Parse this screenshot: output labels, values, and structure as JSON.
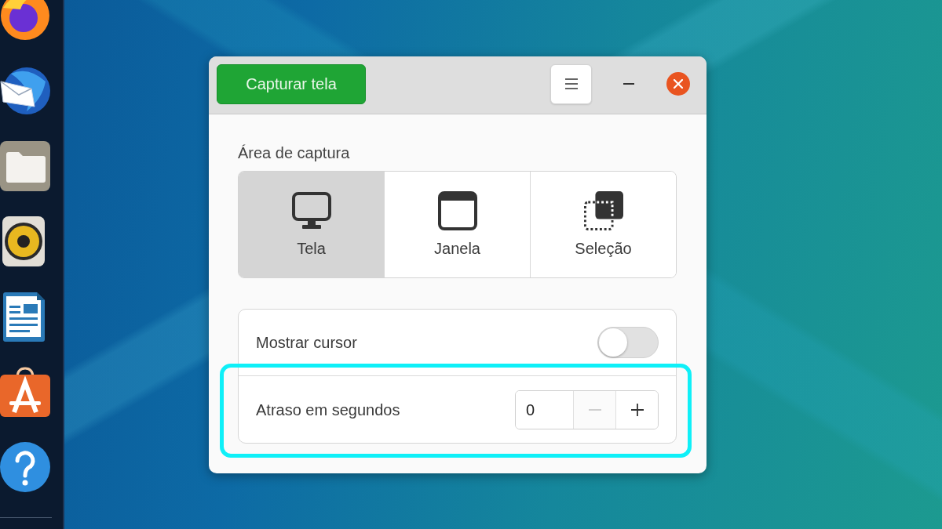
{
  "window": {
    "header": {
      "primary_button": "Capturar tela"
    },
    "capture_area": {
      "label": "Área de captura",
      "options": [
        {
          "kind": "screen",
          "label": "Tela",
          "selected": true
        },
        {
          "kind": "window",
          "label": "Janela",
          "selected": false
        },
        {
          "kind": "selection",
          "label": "Seleção",
          "selected": false
        }
      ]
    },
    "settings": [
      {
        "kind": "switch",
        "label": "Mostrar cursor",
        "on": false,
        "highlighted": false
      },
      {
        "kind": "spin",
        "label": "Atraso em segundos",
        "value": "0",
        "highlighted": true,
        "buttons": [
          {
            "kind": "decrement",
            "disabled": true
          },
          {
            "kind": "increment",
            "disabled": false
          }
        ]
      }
    ]
  }
}
